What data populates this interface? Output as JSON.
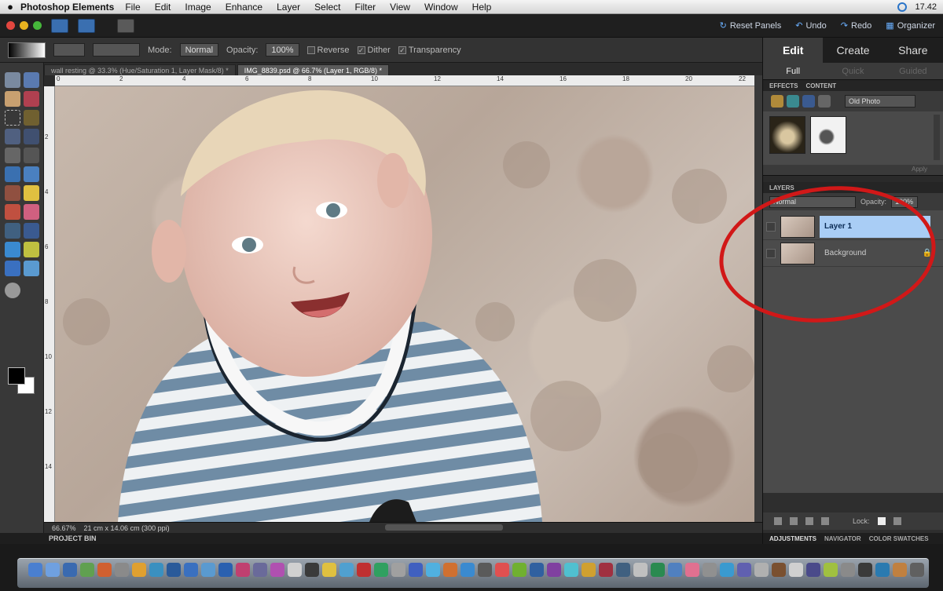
{
  "menubar": {
    "apple": "",
    "app": "Photoshop Elements",
    "items": [
      "File",
      "Edit",
      "Image",
      "Enhance",
      "Layer",
      "Select",
      "Filter",
      "View",
      "Window",
      "Help"
    ],
    "clock": "17.42"
  },
  "ps_top": {
    "reset_panels": "Reset Panels",
    "undo": "Undo",
    "redo": "Redo",
    "organizer": "Organizer"
  },
  "options": {
    "mode_label": "Mode:",
    "mode_value": "Normal",
    "opacity_label": "Opacity:",
    "opacity_value": "100%",
    "reverse": "Reverse",
    "dither": "Dither",
    "transparency": "Transparency"
  },
  "tabs": [
    {
      "label": "wall resting @ 33.3% (Hue/Saturation 1, Layer Mask/8) *"
    },
    {
      "label": "IMG_8839.psd @ 66.7% (Layer 1, RGB/8) *"
    }
  ],
  "ruler": {
    "h": [
      "0",
      "2",
      "4",
      "6",
      "8",
      "10",
      "12",
      "14",
      "16",
      "18",
      "20",
      "22"
    ],
    "v": [
      "2",
      "4",
      "6",
      "8",
      "10",
      "12",
      "14"
    ]
  },
  "status": {
    "zoom": "66.67%",
    "size": "21 cm x 14.06 cm (300 ppi)"
  },
  "project_bin": "PROJECT BIN",
  "panel": {
    "modes": [
      "Edit",
      "Create",
      "Share"
    ],
    "subtabs": [
      "Full",
      "Quick",
      "Guided"
    ],
    "effects_tabs": [
      "EFFECTS",
      "CONTENT"
    ],
    "effects_select": "Old Photo",
    "apply": "Apply",
    "layers_title": "LAYERS",
    "blend": "Normal",
    "opacity": "Opacity:",
    "opacity_value": "100%",
    "layers": [
      {
        "name": "Layer 1",
        "selected": true
      },
      {
        "name": "Background",
        "selected": false
      }
    ],
    "lock": "Lock:",
    "bottom_tabs": [
      "ADJUSTMENTS",
      "NAVIGATOR",
      "COLOR SWATCHES"
    ]
  },
  "colors": {
    "selected_layer": "#a9cdf5",
    "annotation": "#d11818"
  }
}
